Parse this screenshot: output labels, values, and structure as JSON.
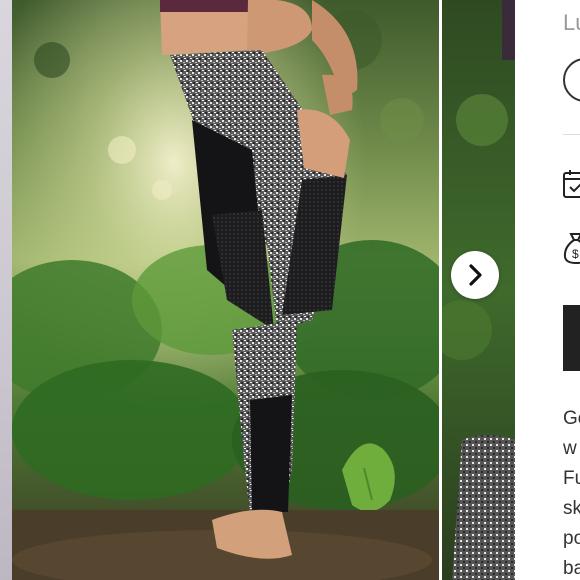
{
  "carousel": {
    "next_button_icon": "chevron-right-icon",
    "main_image": "photo of a person stretching outdoors wearing black and heather-grey mesh-panel leggings"
  },
  "product": {
    "title": "Lu",
    "option_icon": "circle-option",
    "shipping_icon": "calendar-check-icon",
    "price_icon": "money-bag-icon",
    "description_lines": [
      "Ge",
      "w",
      "Fu",
      "sk",
      "po",
      "ba"
    ]
  },
  "colors": {
    "title_gray": "#9a9a9a",
    "text": "#333333",
    "button_dark": "#222222"
  }
}
